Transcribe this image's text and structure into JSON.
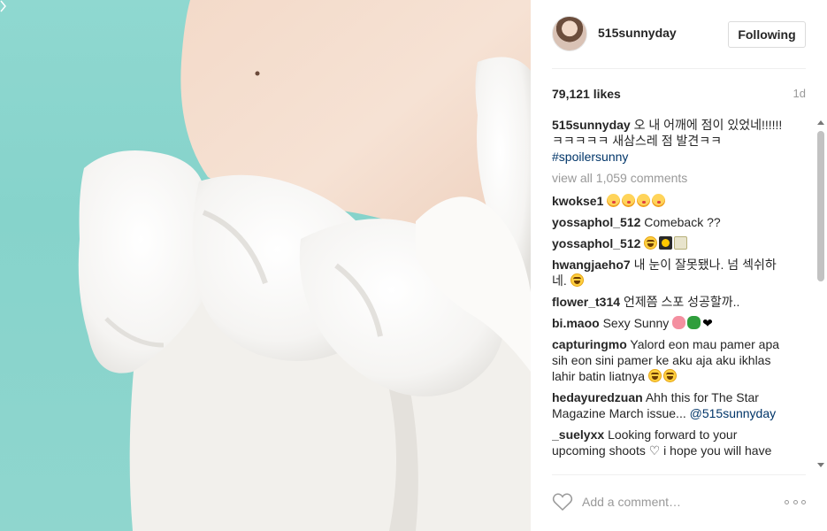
{
  "post": {
    "username": "515sunnyday",
    "follow_label": "Following",
    "likes": "79,121 likes",
    "time_ago": "1d",
    "view_all": "view all 1,059 comments",
    "add_comment_placeholder": "Add a comment…"
  },
  "caption": {
    "author": "515sunnyday",
    "text": "오 내 어깨에 점이 있었네!!!!!!ㅋㅋㅋㅋㅋ 새삼스레 점 발견ㅋㅋ",
    "hashtag": "#spoilersunny"
  },
  "comments": [
    {
      "author": "kwokse1",
      "text": "",
      "emojis": [
        "kiss",
        "kiss",
        "kiss",
        "kiss"
      ]
    },
    {
      "author": "yossaphol_512",
      "text": "Comeback ??",
      "emojis": []
    },
    {
      "author": "yossaphol_512",
      "text": "",
      "emojis": [
        "laugh",
        "sq",
        "bolt"
      ]
    },
    {
      "author": "hwangjaeho7",
      "text": "내 눈이 잘못됐나. 넘 섹쉬하네.",
      "emojis": [
        "laugh"
      ]
    },
    {
      "author": "flower_t314",
      "text": "언제쯤 스포 성공할까..",
      "emojis": []
    },
    {
      "author": "bi.maoo",
      "text": "Sexy Sunny",
      "emojis": [
        "pig",
        "clover",
        "heart"
      ]
    },
    {
      "author": "capturingmo",
      "text": "Yalord eon mau pamer apa sih eon sini pamer ke aku aja aku ikhlas lahir batin liatnya",
      "emojis": [
        "laugh",
        "laugh"
      ]
    },
    {
      "author": "hedayuredzuan",
      "text": "Ahh this for The Star Magazine March issue...",
      "mention": "@515sunnyday",
      "emojis": []
    },
    {
      "author": "_suelyxx",
      "text": "Looking forward to your upcoming shoots ♡ i hope you will have",
      "emojis": []
    }
  ],
  "icons": {
    "like": "heart-outline-icon",
    "more": "more-options-icon"
  },
  "colors": {
    "photo_background": "#8fd8d0",
    "link": "#003569",
    "muted": "#999999"
  }
}
